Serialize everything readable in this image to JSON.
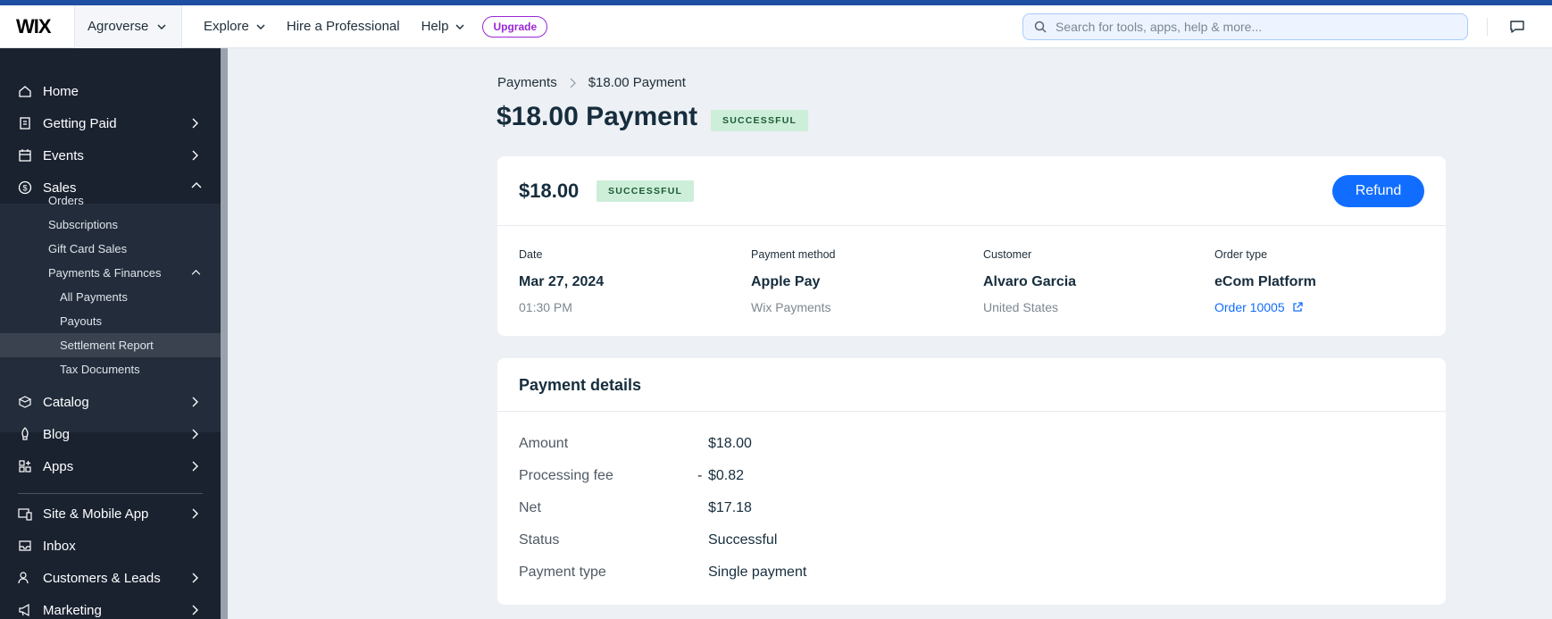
{
  "topbar": {
    "logo": "WIX",
    "site_name": "Agroverse",
    "nav": [
      "Explore",
      "Hire a Professional",
      "Help"
    ],
    "upgrade_label": "Upgrade",
    "search_placeholder": "Search for tools, apps, help & more..."
  },
  "sidebar": {
    "main_items": [
      {
        "label": "Home",
        "icon": "home-icon"
      },
      {
        "label": "Getting Paid",
        "icon": "invoice-icon"
      },
      {
        "label": "Events",
        "icon": "calendar-icon"
      },
      {
        "label": "Sales",
        "icon": "dollar-circle-icon"
      }
    ],
    "sales_items": [
      "Orders",
      "Subscriptions",
      "Gift Card Sales",
      "Payments & Finances"
    ],
    "finance_items": [
      "All Payments",
      "Payouts",
      "Settlement Report",
      "Tax Documents"
    ],
    "more_items": [
      {
        "label": "Catalog",
        "icon": "catalog-icon"
      },
      {
        "label": "Blog",
        "icon": "pen-icon"
      },
      {
        "label": "Apps",
        "icon": "apps-icon"
      }
    ],
    "bottom_items": [
      {
        "label": "Site & Mobile App",
        "icon": "site-icon"
      },
      {
        "label": "Inbox",
        "icon": "inbox-icon"
      },
      {
        "label": "Customers & Leads",
        "icon": "customers-icon"
      },
      {
        "label": "Marketing",
        "icon": "megaphone-icon"
      }
    ]
  },
  "breadcrumb": {
    "root": "Payments",
    "current": "$18.00 Payment"
  },
  "page": {
    "title": "$18.00 Payment",
    "status": "SUCCESSFUL"
  },
  "summary": {
    "amount": "$18.00",
    "status": "SUCCESSFUL",
    "refund_label": "Refund",
    "columns": [
      {
        "label": "Date",
        "value": "Mar 27, 2024",
        "sub": "01:30 PM"
      },
      {
        "label": "Payment method",
        "value": "Apple Pay",
        "sub": "Wix Payments"
      },
      {
        "label": "Customer",
        "value": "Alvaro Garcia",
        "sub": "United States"
      },
      {
        "label": "Order type",
        "value": "eCom Platform",
        "sub": "Order 10005"
      }
    ]
  },
  "details": {
    "heading": "Payment details",
    "rows": [
      {
        "key": "Amount",
        "value": "$18.00"
      },
      {
        "key": "Processing fee",
        "prefix": "-",
        "value": "$0.82"
      },
      {
        "key": "Net",
        "value": "$17.18"
      },
      {
        "key": "Status",
        "value": "Successful"
      },
      {
        "key": "Payment type",
        "value": "Single payment"
      }
    ]
  },
  "colors": {
    "accent": "#116dff",
    "sidebar": "#1a2230",
    "success_bg": "#cdeed9",
    "upgrade": "#9a27d5"
  }
}
